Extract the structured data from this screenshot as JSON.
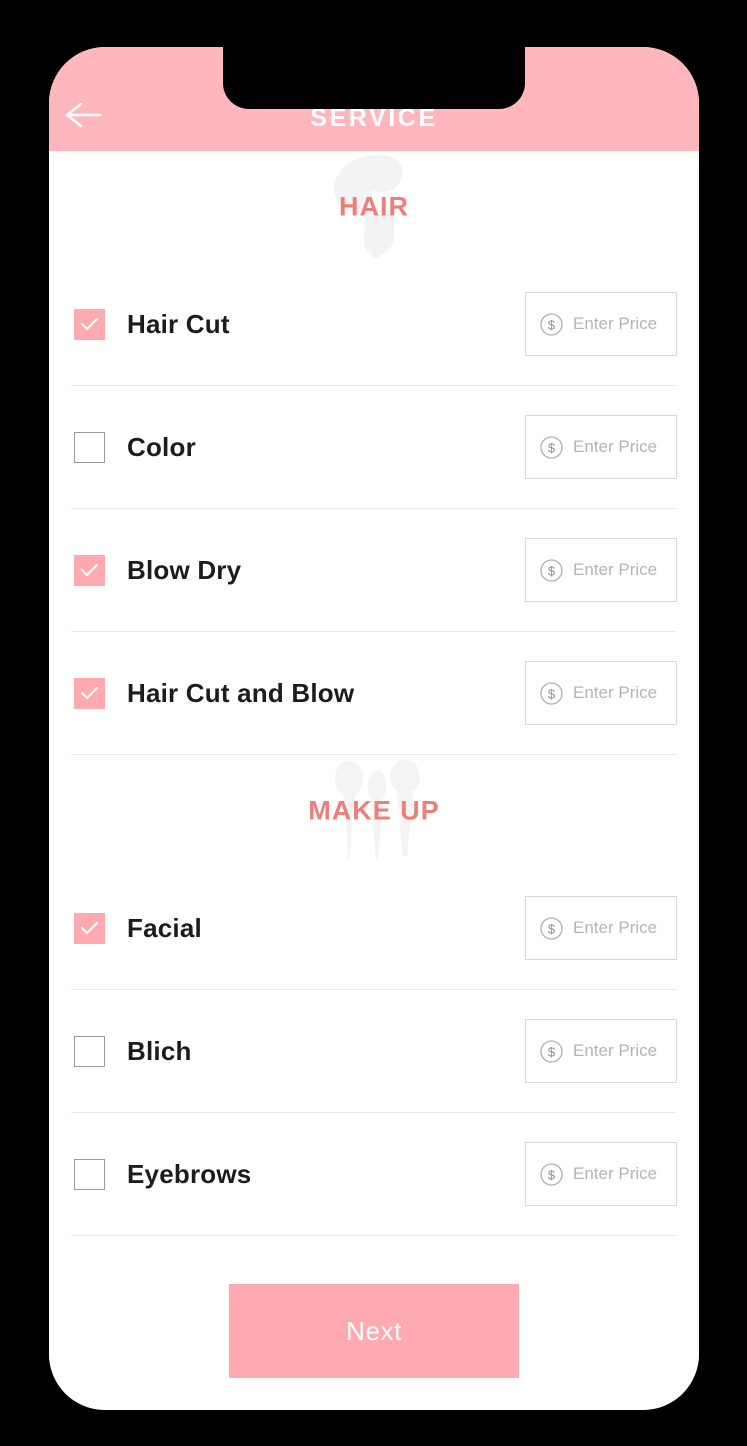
{
  "header": {
    "title": "SERVICE",
    "back_icon": "arrow-left-icon",
    "background_color": "#ffb7bd"
  },
  "theme": {
    "accent_pink": "#ffaab0",
    "header_pink": "#ffb7bd",
    "section_title_color": "#ec8079",
    "label_color": "#1c1c1c",
    "placeholder_color": "#b4b4b4",
    "divider_color": "#eaeaea"
  },
  "sections": [
    {
      "title": "HAIR",
      "watermark_icon": "hairdryer-icon",
      "items": [
        {
          "label": "Hair Cut",
          "checked": true,
          "price_placeholder": "Enter Price",
          "price_value": "",
          "currency_icon": "dollar-circle-icon"
        },
        {
          "label": "Color",
          "checked": false,
          "price_placeholder": "Enter Price",
          "price_value": "",
          "currency_icon": "dollar-circle-icon"
        },
        {
          "label": "Blow Dry",
          "checked": true,
          "price_placeholder": "Enter Price",
          "price_value": "",
          "currency_icon": "dollar-circle-icon"
        },
        {
          "label": "Hair Cut and Blow",
          "checked": true,
          "price_placeholder": "Enter Price",
          "price_value": "",
          "currency_icon": "dollar-circle-icon"
        }
      ]
    },
    {
      "title": "MAKE UP",
      "watermark_icon": "makeup-brushes-icon",
      "items": [
        {
          "label": "Facial",
          "checked": true,
          "price_placeholder": "Enter Price",
          "price_value": "",
          "currency_icon": "dollar-circle-icon"
        },
        {
          "label": "Blich",
          "checked": false,
          "price_placeholder": "Enter Price",
          "price_value": "",
          "currency_icon": "dollar-circle-icon"
        },
        {
          "label": "Eyebrows",
          "checked": false,
          "price_placeholder": "Enter Price",
          "price_value": "",
          "currency_icon": "dollar-circle-icon"
        }
      ]
    }
  ],
  "footer": {
    "next_label": "Next"
  }
}
